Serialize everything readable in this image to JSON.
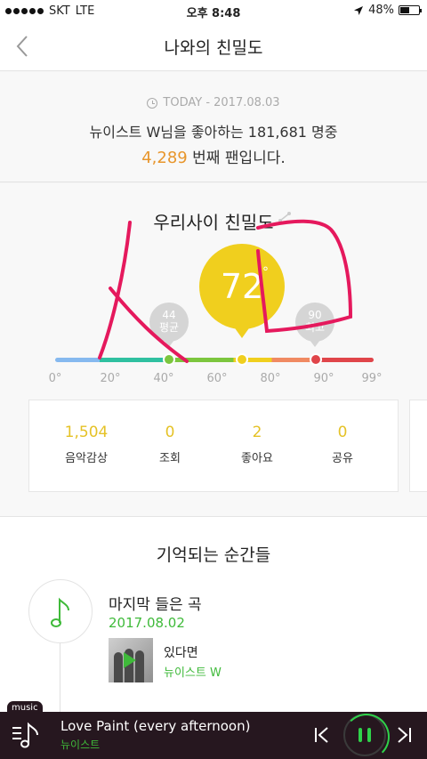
{
  "status_bar": {
    "carrier": "SKT",
    "network": "LTE",
    "time": "오후 8:48",
    "battery": "48%"
  },
  "header": {
    "title": "나와의 친밀도"
  },
  "today": {
    "date": "TODAY - 2017.08.03",
    "line1": "뉴이스트 W님을 좋아하는 181,681 명중",
    "rank": "4,289",
    "rank_suffix": " 번째 팬입니다."
  },
  "intimacy": {
    "title": "우리사이 친밀도",
    "value": "72",
    "value_degree": "°",
    "avg": {
      "value": "44",
      "label": "평균"
    },
    "max": {
      "value": "90",
      "label": "최고"
    },
    "scale": [
      "0°",
      "20°",
      "40°",
      "60°",
      "80°",
      "90°",
      "99°"
    ],
    "markers": {
      "avg": 44,
      "mine": 72,
      "max": 90
    },
    "gauge_colors": [
      "#86b9ef",
      "#2fc0a0",
      "#7cc63e",
      "#f0cf1e",
      "#f08a62",
      "#e0454a"
    ],
    "stats": [
      {
        "value": "1,504",
        "label": "음악감상"
      },
      {
        "value": "0",
        "label": "조회"
      },
      {
        "value": "2",
        "label": "좋아요"
      },
      {
        "value": "0",
        "label": "공유"
      }
    ]
  },
  "moments": {
    "title": "기억되는 순간들",
    "item": {
      "icon": "music-note-icon",
      "label": "마지막 들은 곡",
      "date": "2017.08.02",
      "song": "있다면",
      "artist": "뉴이스트 W"
    }
  },
  "player": {
    "tag": "music",
    "title": "Love Paint (every afternoon)",
    "artist": "뉴이스트",
    "accent": "#2fd24a"
  }
}
